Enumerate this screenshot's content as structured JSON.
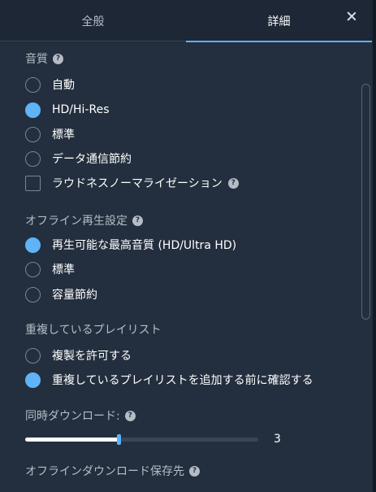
{
  "tabs": {
    "general": "全般",
    "detail": "詳細"
  },
  "quality": {
    "title": "音質",
    "options": [
      {
        "label": "自動",
        "selected": false
      },
      {
        "label": "HD/Hi-Res",
        "selected": true
      },
      {
        "label": "標準",
        "selected": false
      },
      {
        "label": "データ通信節約",
        "selected": false
      }
    ],
    "loudness_label": "ラウドネスノーマライゼーション",
    "loudness_checked": false
  },
  "offline": {
    "title": "オフライン再生設定",
    "options": [
      {
        "label": "再生可能な最高音質 (HD/Ultra HD)",
        "selected": true
      },
      {
        "label": "標準",
        "selected": false
      },
      {
        "label": "容量節約",
        "selected": false
      }
    ]
  },
  "duplicate": {
    "title": "重複しているプレイリスト",
    "options": [
      {
        "label": "複製を許可する",
        "selected": false
      },
      {
        "label": "重複しているプレイリストを追加する前に確認する",
        "selected": true
      }
    ]
  },
  "concurrent": {
    "title": "同時ダウンロード:",
    "value": "3",
    "fraction": 0.4
  },
  "storage": {
    "title": "オフラインダウンロード保存先"
  },
  "icons": {
    "help": "?",
    "close": "close-icon"
  },
  "colors": {
    "accent": "#5fb3f6",
    "background": "#232f3e"
  }
}
